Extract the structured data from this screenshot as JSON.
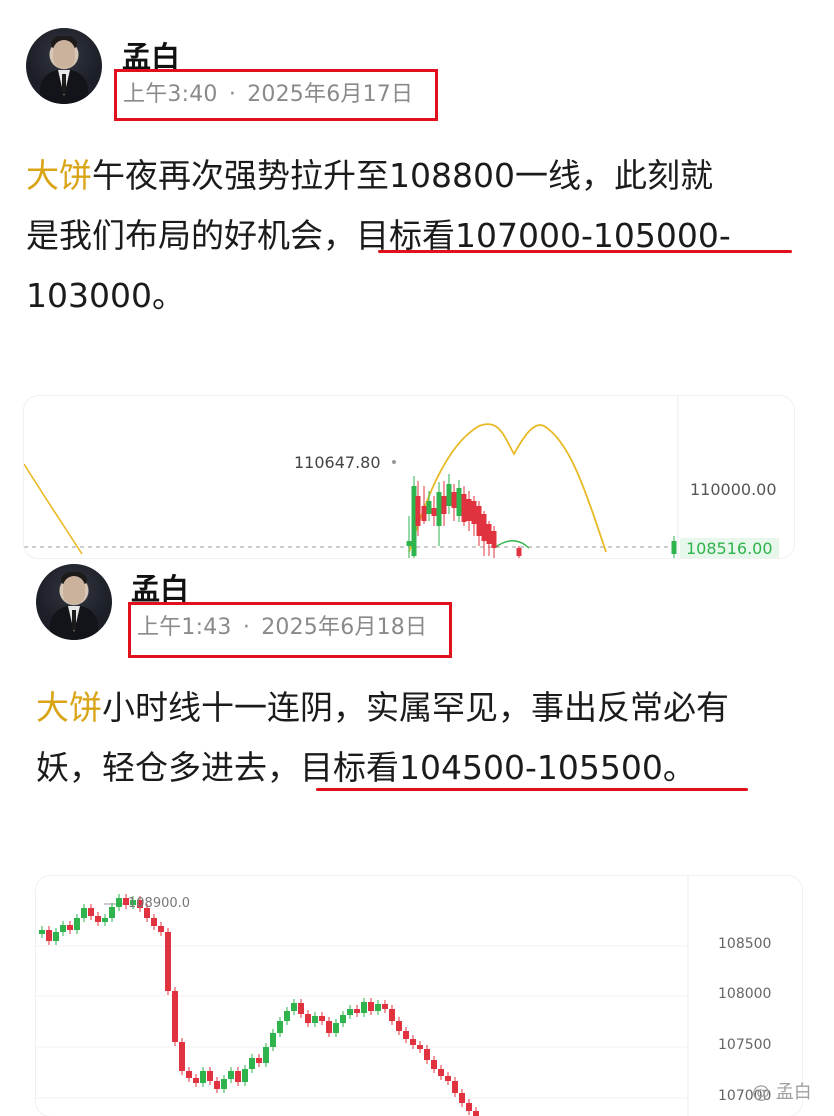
{
  "post1": {
    "username": "孟白",
    "time": "上午3:40",
    "date": "2025年6月17日",
    "keyword": "大饼",
    "line1_rest": "午夜再次强势拉升至108800一线，此刻就",
    "line2_plain": "是我们布局的好机会，",
    "line2_target": "目标看107000-105000-",
    "line3": "103000。",
    "chart": {
      "high_label": "110647.80",
      "axis_label_top": "110000.00",
      "price_label": "108516.00"
    }
  },
  "post2": {
    "username": "孟白",
    "time": "上午1:43",
    "date": "2025年6月18日",
    "keyword": "大饼",
    "line1_rest": "小时线十一连阴，实属罕见，事出反常必有",
    "line2_plain": "妖，轻仓多进去，",
    "line2_target": "目标看104500-105500。",
    "chart": {
      "high_label": "108900.0",
      "axis_labels": [
        "108500",
        "108000",
        "107500",
        "107000"
      ]
    }
  },
  "watermark": "@ 孟白",
  "colors": {
    "up": "#2fb34c",
    "down": "#e0333f",
    "ma": "#e8b923",
    "highlight": "#e0111a",
    "keyword": "#d9a416"
  }
}
